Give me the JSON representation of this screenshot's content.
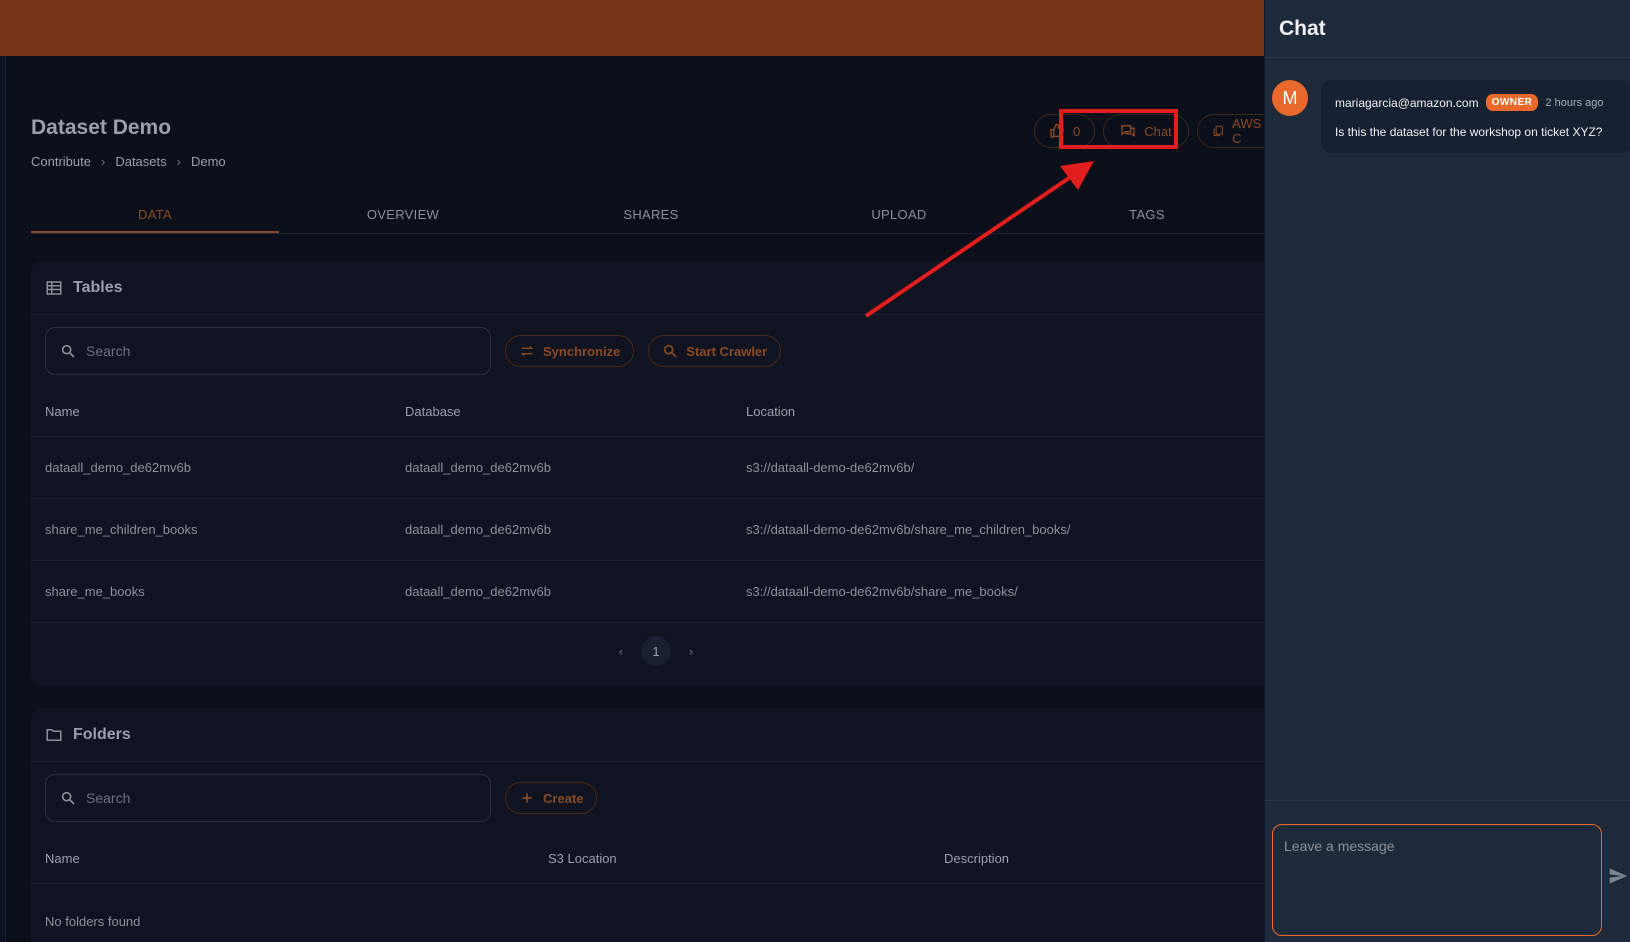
{
  "page": {
    "title": "Dataset Demo",
    "breadcrumb": [
      "Contribute",
      "Datasets",
      "Demo"
    ]
  },
  "actions": {
    "upvotes": "0",
    "chat_label": "Chat",
    "aws_label": "AWS C"
  },
  "tabs": [
    "DATA",
    "OVERVIEW",
    "SHARES",
    "UPLOAD",
    "TAGS"
  ],
  "tables": {
    "title": "Tables",
    "search_placeholder": "Search",
    "synchronize_label": "Synchronize",
    "crawler_label": "Start Crawler",
    "columns": [
      "Name",
      "Database",
      "Location"
    ],
    "rows": [
      [
        "dataall_demo_de62mv6b",
        "dataall_demo_de62mv6b",
        "s3://dataall-demo-de62mv6b/"
      ],
      [
        "share_me_children_books",
        "dataall_demo_de62mv6b",
        "s3://dataall-demo-de62mv6b/share_me_children_books/"
      ],
      [
        "share_me_books",
        "dataall_demo_de62mv6b",
        "s3://dataall-demo-de62mv6b/share_me_books/"
      ]
    ],
    "page": "1"
  },
  "folders": {
    "title": "Folders",
    "search_placeholder": "Search",
    "create_label": "Create",
    "columns": [
      "Name",
      "S3 Location",
      "Description"
    ],
    "empty_text": "No folders found"
  },
  "chat": {
    "title": "Chat",
    "messages": [
      {
        "avatar": "M",
        "author": "mariagarcia@amazon.com",
        "badge": "OWNER",
        "time": "2 hours ago",
        "text": "Is this the dataset for the workshop on ticket XYZ?"
      }
    ],
    "input_placeholder": "Leave a message"
  },
  "colors": {
    "accent": "#e8692b",
    "topbar": "#733415",
    "annotation": "#e21d1d"
  }
}
